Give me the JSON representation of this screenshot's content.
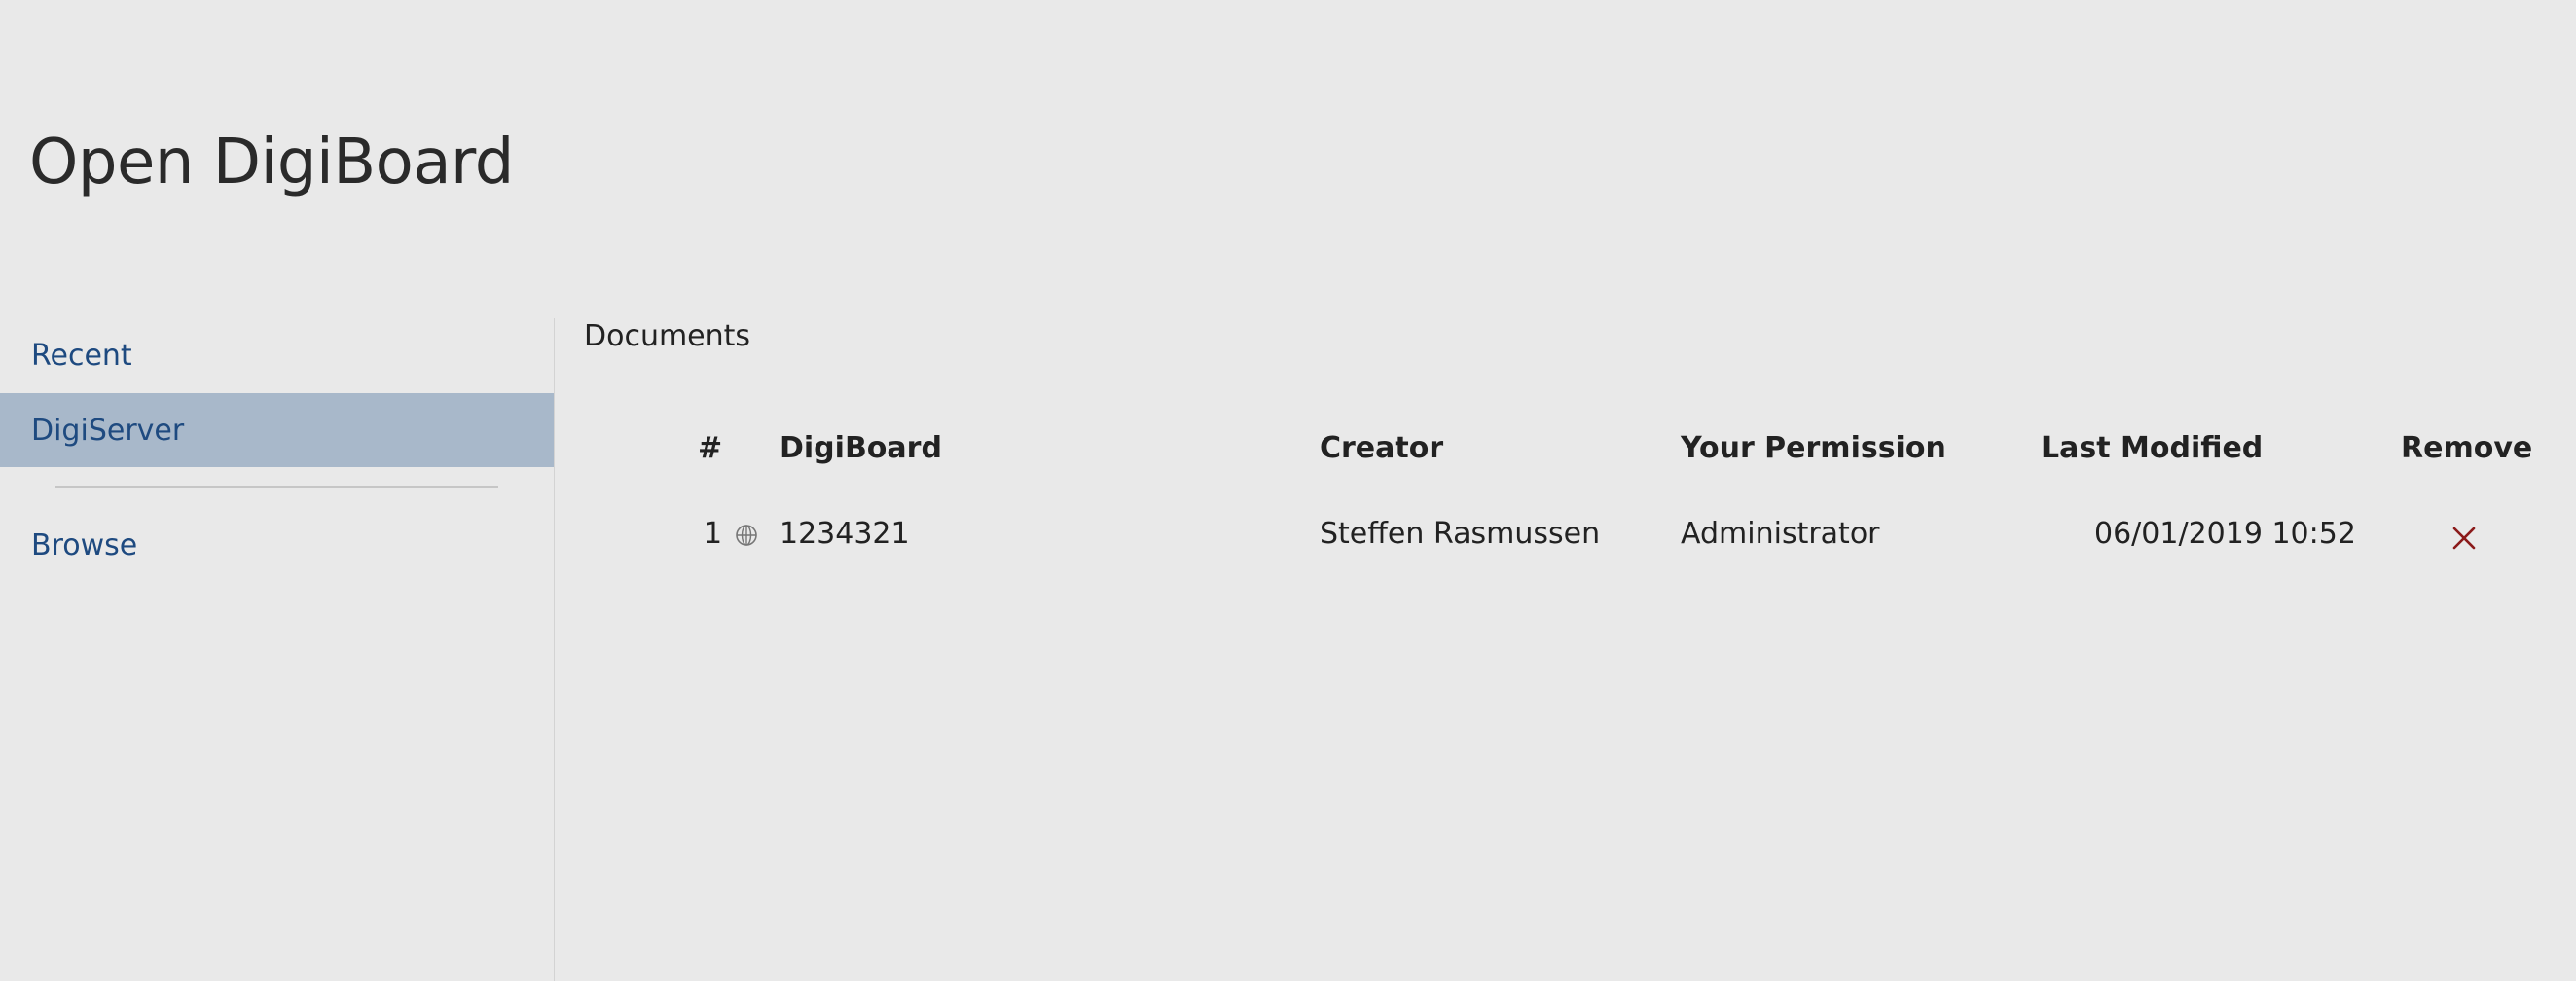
{
  "page": {
    "title": "Open DigiBoard"
  },
  "sidebar": {
    "items": [
      {
        "label": "Recent"
      },
      {
        "label": "DigiServer"
      },
      {
        "label": "Browse"
      }
    ]
  },
  "main": {
    "section_label": "Documents",
    "table": {
      "columns": [
        "#",
        "DigiBoard",
        "Creator",
        "Your Permission",
        "Last Modified",
        "Remove"
      ],
      "rows": [
        {
          "index": "1",
          "icon": "globe-icon",
          "digiboard": "1234321",
          "creator": "Steffen Rasmussen",
          "permission": "Administrator",
          "last_modified": "06/01/2019 10:52",
          "remove_icon": "close-icon"
        }
      ]
    }
  },
  "colors": {
    "background": "#e9e9e9",
    "sidebar_selected": "#a8b8ca",
    "link": "#1e4a80",
    "remove": "#8b1a1a"
  }
}
